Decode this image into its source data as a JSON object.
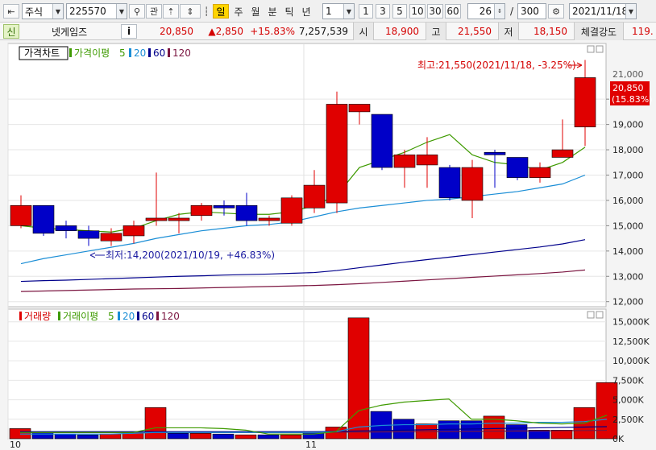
{
  "toolbar": {
    "market_type": "주식",
    "code": "225570",
    "btn_watch": "관",
    "period_buttons": [
      "일",
      "주",
      "월",
      "분",
      "틱",
      "년"
    ],
    "selected_period": "일",
    "unit_value": "1",
    "quick_units": [
      "1",
      "3",
      "5",
      "10",
      "30",
      "60"
    ],
    "count_value": "26",
    "slash": "/",
    "total_value": "300",
    "date_value": "2021/11/18"
  },
  "quote": {
    "market_badge": "신",
    "name": "넷게임즈",
    "info_btn": "i",
    "price": "20,850",
    "change": "▲2,850",
    "change_pct": "+15.83%",
    "volume": "7,257,539",
    "open_label": "시",
    "open": "18,900",
    "high_label": "고",
    "high": "21,550",
    "low_label": "저",
    "low": "18,150",
    "strength_label": "체결강도",
    "strength": "119."
  },
  "colors": {
    "up": "#e00000",
    "down": "#0000c8",
    "ma5": "#3e9a00",
    "ma20": "#1b8ed6",
    "ma60": "#00008b",
    "ma120": "#7b1540",
    "annot": "#d40000",
    "annot_low": "#1a1aa0"
  },
  "chart_data": [
    {
      "type": "candlestick",
      "title": "가격차트",
      "legend": [
        {
          "name": "가격이평",
          "color": "#3e9a00"
        },
        {
          "name": "5",
          "color": "#3e9a00"
        },
        {
          "name": "20",
          "color": "#1b8ed6"
        },
        {
          "name": "60",
          "color": "#00008b"
        },
        {
          "name": "120",
          "color": "#7b1540"
        }
      ],
      "ylim": [
        11800,
        22200
      ],
      "yticks": [
        "12,000",
        "13,000",
        "14,000",
        "15,000",
        "16,000",
        "17,000",
        "18,000",
        "19,000",
        "20,000"
      ],
      "ytick_values": [
        12000,
        13000,
        14000,
        15000,
        16000,
        17000,
        18000,
        19000,
        20000
      ],
      "partial_top_tick": "21,000",
      "x_labels": [
        {
          "index": 0,
          "label": "10"
        },
        {
          "index": 13,
          "label": "11"
        }
      ],
      "candles": [
        {
          "o": 15000,
          "h": 16200,
          "l": 14900,
          "c": 15800
        },
        {
          "o": 15800,
          "h": 15800,
          "l": 14600,
          "c": 14700
        },
        {
          "o": 15000,
          "h": 15200,
          "l": 14500,
          "c": 14800
        },
        {
          "o": 14800,
          "h": 15000,
          "l": 14200,
          "c": 14500
        },
        {
          "o": 14400,
          "h": 14900,
          "l": 14200,
          "c": 14700
        },
        {
          "o": 14600,
          "h": 15200,
          "l": 14300,
          "c": 15000
        },
        {
          "o": 15200,
          "h": 17100,
          "l": 15000,
          "c": 15300
        },
        {
          "o": 15200,
          "h": 15500,
          "l": 14700,
          "c": 15300
        },
        {
          "o": 15400,
          "h": 15900,
          "l": 15200,
          "c": 15800
        },
        {
          "o": 15800,
          "h": 16000,
          "l": 15400,
          "c": 15700
        },
        {
          "o": 15800,
          "h": 16300,
          "l": 15000,
          "c": 15200
        },
        {
          "o": 15200,
          "h": 15400,
          "l": 15000,
          "c": 15300
        },
        {
          "o": 15100,
          "h": 16200,
          "l": 15000,
          "c": 16100
        },
        {
          "o": 15700,
          "h": 17200,
          "l": 15500,
          "c": 16600
        },
        {
          "o": 15900,
          "h": 20300,
          "l": 15500,
          "c": 19800
        },
        {
          "o": 19500,
          "h": 19800,
          "l": 19000,
          "c": 19800
        },
        {
          "o": 19400,
          "h": 19400,
          "l": 17200,
          "c": 17300
        },
        {
          "o": 17300,
          "h": 18000,
          "l": 16500,
          "c": 17800
        },
        {
          "o": 17400,
          "h": 18500,
          "l": 16500,
          "c": 17800
        },
        {
          "o": 17300,
          "h": 17400,
          "l": 16000,
          "c": 16100
        },
        {
          "o": 16000,
          "h": 17600,
          "l": 15300,
          "c": 17300
        },
        {
          "o": 17900,
          "h": 18000,
          "l": 16500,
          "c": 17800
        },
        {
          "o": 17700,
          "h": 17700,
          "l": 16800,
          "c": 16900
        },
        {
          "o": 16900,
          "h": 17500,
          "l": 16700,
          "c": 17300
        },
        {
          "o": 17700,
          "h": 19200,
          "l": 17700,
          "c": 18000
        },
        {
          "o": 18900,
          "h": 21550,
          "l": 18150,
          "c": 20850
        }
      ],
      "ma5": [
        15000,
        14900,
        14850,
        14800,
        14750,
        14900,
        15200,
        15450,
        15550,
        15500,
        15450,
        15450,
        15550,
        15800,
        16200,
        17300,
        17600,
        17900,
        18300,
        18600,
        17800,
        17500,
        17400,
        17200,
        17500,
        18100
      ],
      "ma20": [
        13500,
        13700,
        13850,
        14000,
        14150,
        14300,
        14500,
        14650,
        14800,
        14900,
        15000,
        15050,
        15150,
        15350,
        15550,
        15700,
        15800,
        15900,
        16000,
        16050,
        16150,
        16250,
        16350,
        16500,
        16650,
        17000
      ],
      "ma60": [
        12800,
        12830,
        12850,
        12880,
        12910,
        12940,
        12970,
        13000,
        13020,
        13050,
        13070,
        13090,
        13120,
        13150,
        13230,
        13340,
        13450,
        13560,
        13660,
        13760,
        13860,
        13960,
        14060,
        14160,
        14280,
        14450
      ],
      "ma120": [
        12400,
        12420,
        12440,
        12460,
        12480,
        12500,
        12510,
        12520,
        12540,
        12560,
        12580,
        12600,
        12620,
        12640,
        12670,
        12710,
        12760,
        12810,
        12860,
        12910,
        12960,
        13010,
        13060,
        13110,
        13170,
        13250
      ],
      "price_box": [
        "20,850",
        "(15.83%)"
      ],
      "annotations": {
        "high": "최고:21,550(2021/11/18, -3.25%)",
        "low": "최저:14,200(2021/10/19, +46.83%)"
      }
    },
    {
      "type": "bar",
      "title": "거래량",
      "legend": [
        {
          "name": "거래이평",
          "color": "#3e9a00"
        },
        {
          "name": "5",
          "color": "#3e9a00"
        },
        {
          "name": "20",
          "color": "#1b8ed6"
        },
        {
          "name": "60",
          "color": "#00008b"
        },
        {
          "name": "120",
          "color": "#7b1540"
        }
      ],
      "ylim": [
        0,
        16000
      ],
      "yticks": [
        "0K",
        "2,500K",
        "5,000K",
        "7,500K",
        "10,000K",
        "12,500K",
        "15,000K"
      ],
      "ytick_values": [
        0,
        2500,
        5000,
        7500,
        10000,
        12500,
        15000
      ],
      "unit": "K",
      "values": [
        1300,
        800,
        600,
        500,
        600,
        800,
        4000,
        700,
        700,
        600,
        500,
        500,
        500,
        800,
        1500,
        15500,
        3500,
        2500,
        1900,
        2300,
        2300,
        2900,
        1800,
        1100,
        1100,
        4000,
        7200
      ],
      "up": [
        true,
        false,
        false,
        false,
        true,
        true,
        true,
        false,
        true,
        false,
        true,
        false,
        true,
        false,
        true,
        true,
        false,
        false,
        true,
        false,
        false,
        true,
        false,
        false,
        true,
        true,
        true
      ],
      "ma5": [
        800,
        800,
        800,
        800,
        800,
        800,
        1400,
        1400,
        1400,
        1300,
        1100,
        600,
        600,
        600,
        900,
        3600,
        4300,
        4700,
        4900,
        5100,
        2500,
        2500,
        2300,
        2000,
        1900,
        2000,
        3000
      ],
      "ma20": [
        600,
        600,
        600,
        600,
        600,
        700,
        800,
        800,
        800,
        800,
        800,
        800,
        800,
        800,
        900,
        1500,
        1700,
        1800,
        1800,
        1900,
        1900,
        2000,
        2000,
        2100,
        2100,
        2200,
        2500
      ],
      "ma60": [
        900,
        900,
        900,
        900,
        900,
        900,
        900,
        900,
        900,
        900,
        900,
        900,
        900,
        900,
        950,
        1000,
        1050,
        1100,
        1150,
        1200,
        1250,
        1300,
        1350,
        1400,
        1450,
        1500,
        1550
      ],
      "ma120": [
        800,
        800,
        800,
        800,
        800,
        800,
        800,
        800,
        800,
        800,
        800,
        800,
        800,
        800,
        820,
        850,
        870,
        890,
        910,
        930,
        950,
        970,
        990,
        1010,
        1030,
        1050,
        1080
      ],
      "x_labels": [
        {
          "index": 0,
          "label": "10"
        },
        {
          "index": 13,
          "label": "11"
        }
      ]
    }
  ]
}
